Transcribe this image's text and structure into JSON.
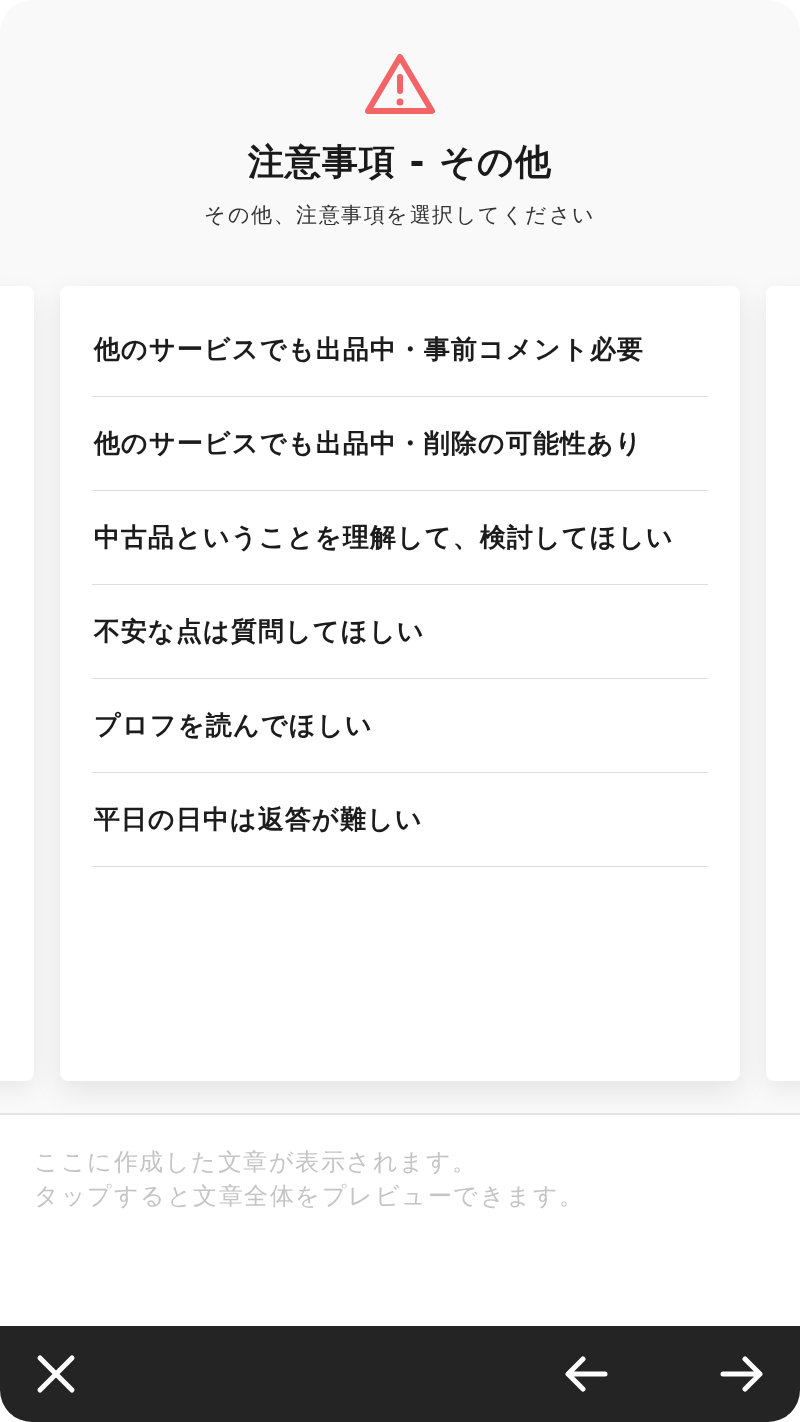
{
  "header": {
    "title": "注意事項 - その他",
    "subtitle": "その他、注意事項を選択してください"
  },
  "options": [
    {
      "label": "他のサービスでも出品中・事前コメント必要"
    },
    {
      "label": "他のサービスでも出品中・削除の可能性あり"
    },
    {
      "label": "中古品ということを理解して、検討してほしい"
    },
    {
      "label": "不安な点は質問してほしい"
    },
    {
      "label": "プロフを読んでほしい"
    },
    {
      "label": "平日の日中は返答が難しい"
    }
  ],
  "preview": {
    "hint_lines": [
      "ここに作成した文章が表示されます。",
      "タップすると文章全体をプレビューできます。"
    ]
  }
}
